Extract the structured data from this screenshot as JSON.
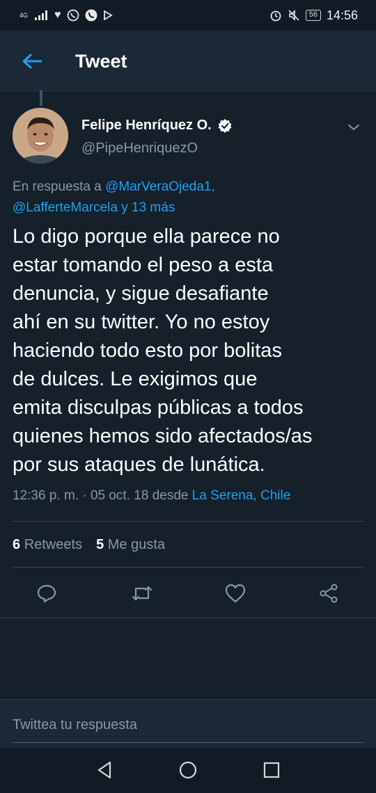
{
  "status_bar": {
    "network": "4G",
    "time": "14:56",
    "battery": "56",
    "left_icons": [
      "signal-icon",
      "heart-icon",
      "whatsapp-icon",
      "phone-icon",
      "play-icon"
    ],
    "right_icons": [
      "alarm-icon",
      "mute-icon",
      "battery-icon"
    ]
  },
  "header": {
    "title": "Tweet"
  },
  "tweet": {
    "author": {
      "name": "Felipe Henríquez O.",
      "handle": "@PipeHenriquezO",
      "verified": true
    },
    "reply_to": {
      "prefix": "En respuesta a",
      "mention1": "@MarVeraOjeda1,",
      "mention2": "@LafferteMarcela",
      "more": "y 13 más"
    },
    "text_lines": [
      "Lo digo porque ella parece no",
      "estar tomando el peso a esta",
      "denuncia, y sigue desafiante",
      "ahí en su twitter. Yo no estoy",
      "haciendo todo esto por bolitas",
      "de dulces. Le exigimos que",
      "emita disculpas públicas a todos",
      "quienes hemos sido afectados/as",
      "por sus ataques de lunática."
    ],
    "meta": {
      "time": "12:36 p. m.",
      "separator": "·",
      "date": "05 oct. 18",
      "from": "desde",
      "place": "La Serena, Chile"
    },
    "stats": {
      "retweets_count": "6",
      "retweets_label": "Retweets",
      "likes_count": "5",
      "likes_label": "Me gusta"
    }
  },
  "reply_bar": {
    "placeholder": "Twittea tu respuesta"
  },
  "colors": {
    "background": "#15202b",
    "accent": "#1da1f2",
    "secondary_text": "#8899a6"
  }
}
